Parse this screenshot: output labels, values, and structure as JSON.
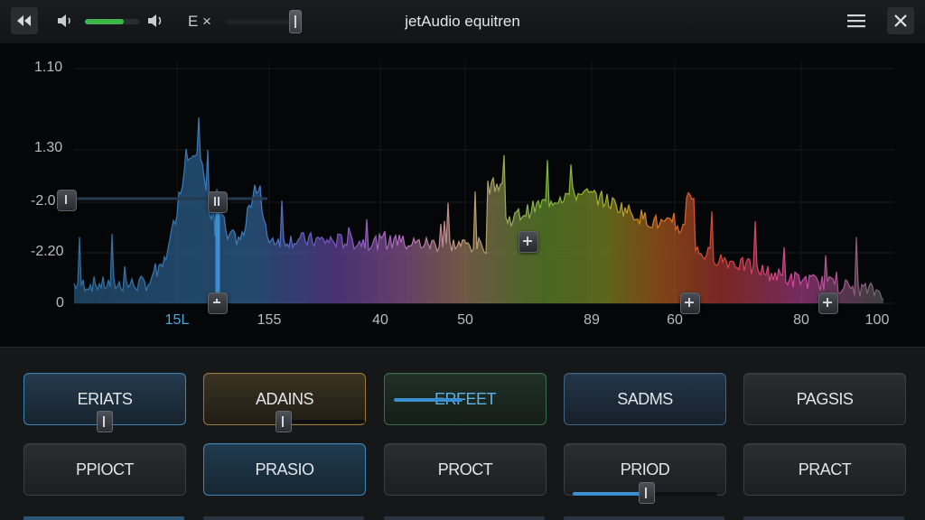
{
  "window": {
    "title": "jetAudio equitren",
    "lang_label": "E ×",
    "volume_level": 0.72,
    "balance_level": 1.0
  },
  "icons": {
    "back": "rewind-icon",
    "volume_low": "speaker-low-icon",
    "volume_high": "speaker-high-icon",
    "menu": "hamburger-menu-icon",
    "close": "close-icon"
  },
  "colors": {
    "accent": "#3b8fd0",
    "volume_fill": "#3fb54a"
  },
  "chart_data": {
    "type": "area",
    "y_tick_labels": [
      "1.10",
      "1.30",
      "-2.0",
      "-2.20",
      "0"
    ],
    "x_tick_labels": [
      "15L",
      "155",
      "40",
      "50",
      "89",
      "60",
      "80",
      "100"
    ],
    "active_x_label": "15L",
    "gradient_colors": [
      "#2f6fa0",
      "#3b7fc0",
      "#7a55c8",
      "#c070c0",
      "#c59a78",
      "#7fb838",
      "#bfa22a",
      "#e07a20",
      "#d8403a",
      "#d04aa8"
    ]
  },
  "presets": [
    {
      "label": "ERIATS"
    },
    {
      "label": "ADAINS"
    },
    {
      "label": "ERFEET"
    },
    {
      "label": "SADMS"
    },
    {
      "label": "PAGSIS"
    },
    {
      "label": "PPIOCT"
    },
    {
      "label": "PRASIO"
    },
    {
      "label": "PROCT"
    },
    {
      "label": "PRIOD"
    },
    {
      "label": "PRACT"
    }
  ]
}
